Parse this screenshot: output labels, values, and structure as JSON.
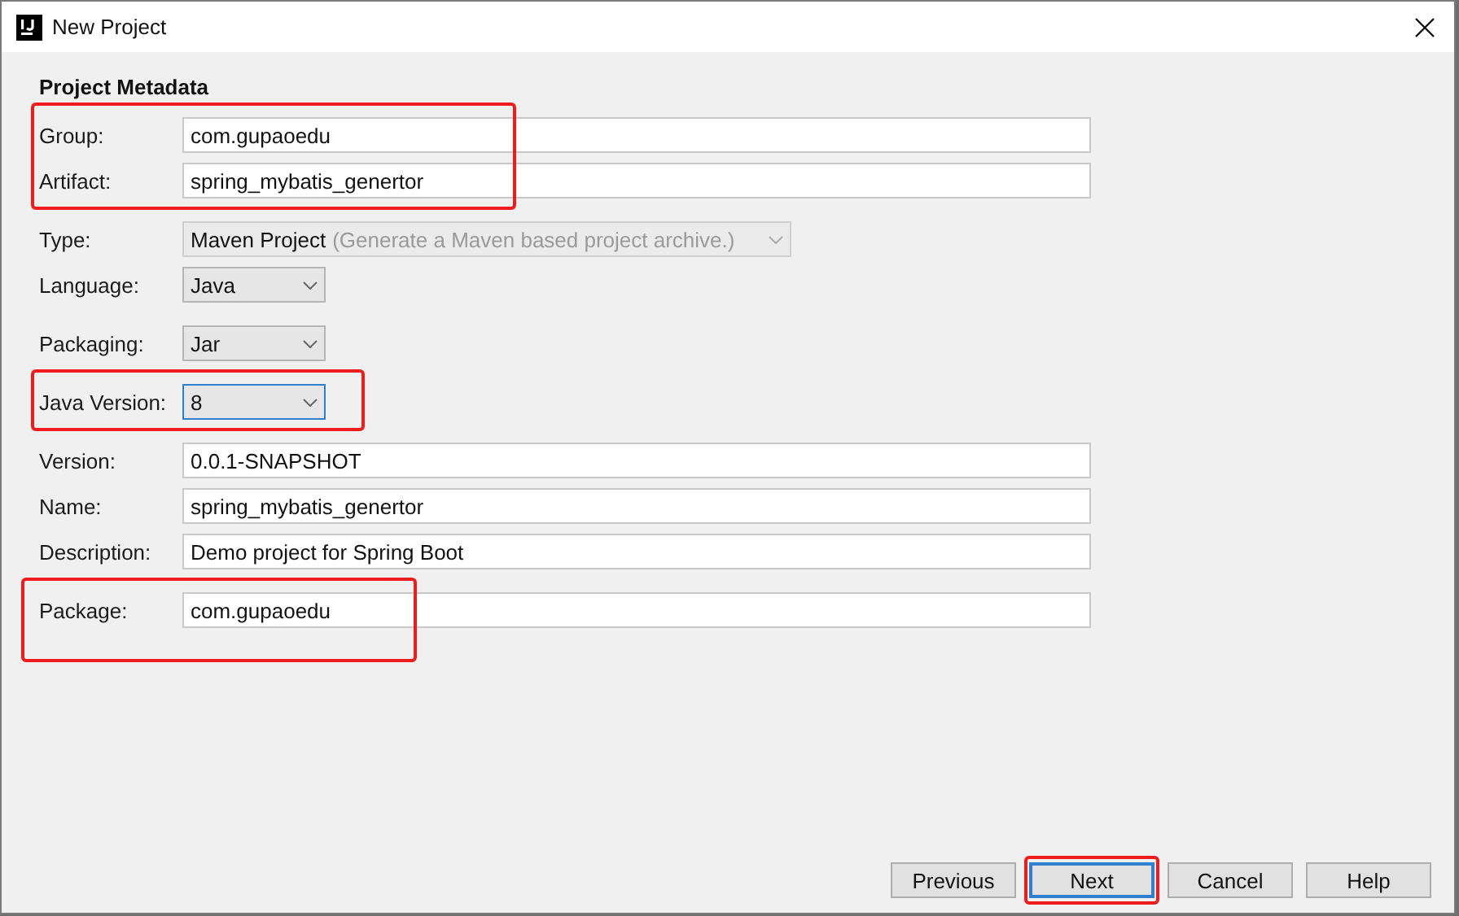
{
  "window": {
    "title": "New Project"
  },
  "section_title": "Project Metadata",
  "sections": [
    {
      "highlighted": true,
      "rows": [
        {
          "label": "Group:",
          "kind": "text",
          "value": "com.gupaoedu"
        },
        {
          "label": "Artifact:",
          "kind": "text",
          "value": "spring_mybatis_genertor"
        }
      ]
    },
    {
      "highlighted": false,
      "rows": [
        {
          "label": "Type:",
          "kind": "combo",
          "value": "Maven Project",
          "hint": "(Generate a Maven based project archive.)",
          "disabled": true,
          "focused": false
        },
        {
          "label": "Language:",
          "kind": "combo",
          "value": "Java",
          "disabled": false,
          "focused": false
        }
      ]
    },
    {
      "highlighted": false,
      "rows": [
        {
          "label": "Packaging:",
          "kind": "combo",
          "value": "Jar",
          "disabled": false,
          "focused": false
        }
      ]
    },
    {
      "highlighted": true,
      "rows": [
        {
          "label": "Java Version:",
          "kind": "combo",
          "value": "8",
          "disabled": false,
          "focused": true
        }
      ]
    },
    {
      "highlighted": false,
      "rows": [
        {
          "label": "Version:",
          "kind": "text",
          "value": "0.0.1-SNAPSHOT"
        },
        {
          "label": "Name:",
          "kind": "text",
          "value": "spring_mybatis_genertor"
        },
        {
          "label": "Description:",
          "kind": "text",
          "value": "Demo project for Spring Boot"
        }
      ]
    },
    {
      "highlighted": true,
      "rows": [
        {
          "label": "Package:",
          "kind": "text",
          "value": "com.gupaoedu"
        }
      ]
    }
  ],
  "buttons": [
    {
      "label": "Previous",
      "default": false,
      "highlighted": false
    },
    {
      "label": "Next",
      "default": true,
      "highlighted": true
    },
    {
      "label": "Cancel",
      "default": false,
      "highlighted": false
    },
    {
      "label": "Help",
      "default": false,
      "highlighted": false
    }
  ]
}
